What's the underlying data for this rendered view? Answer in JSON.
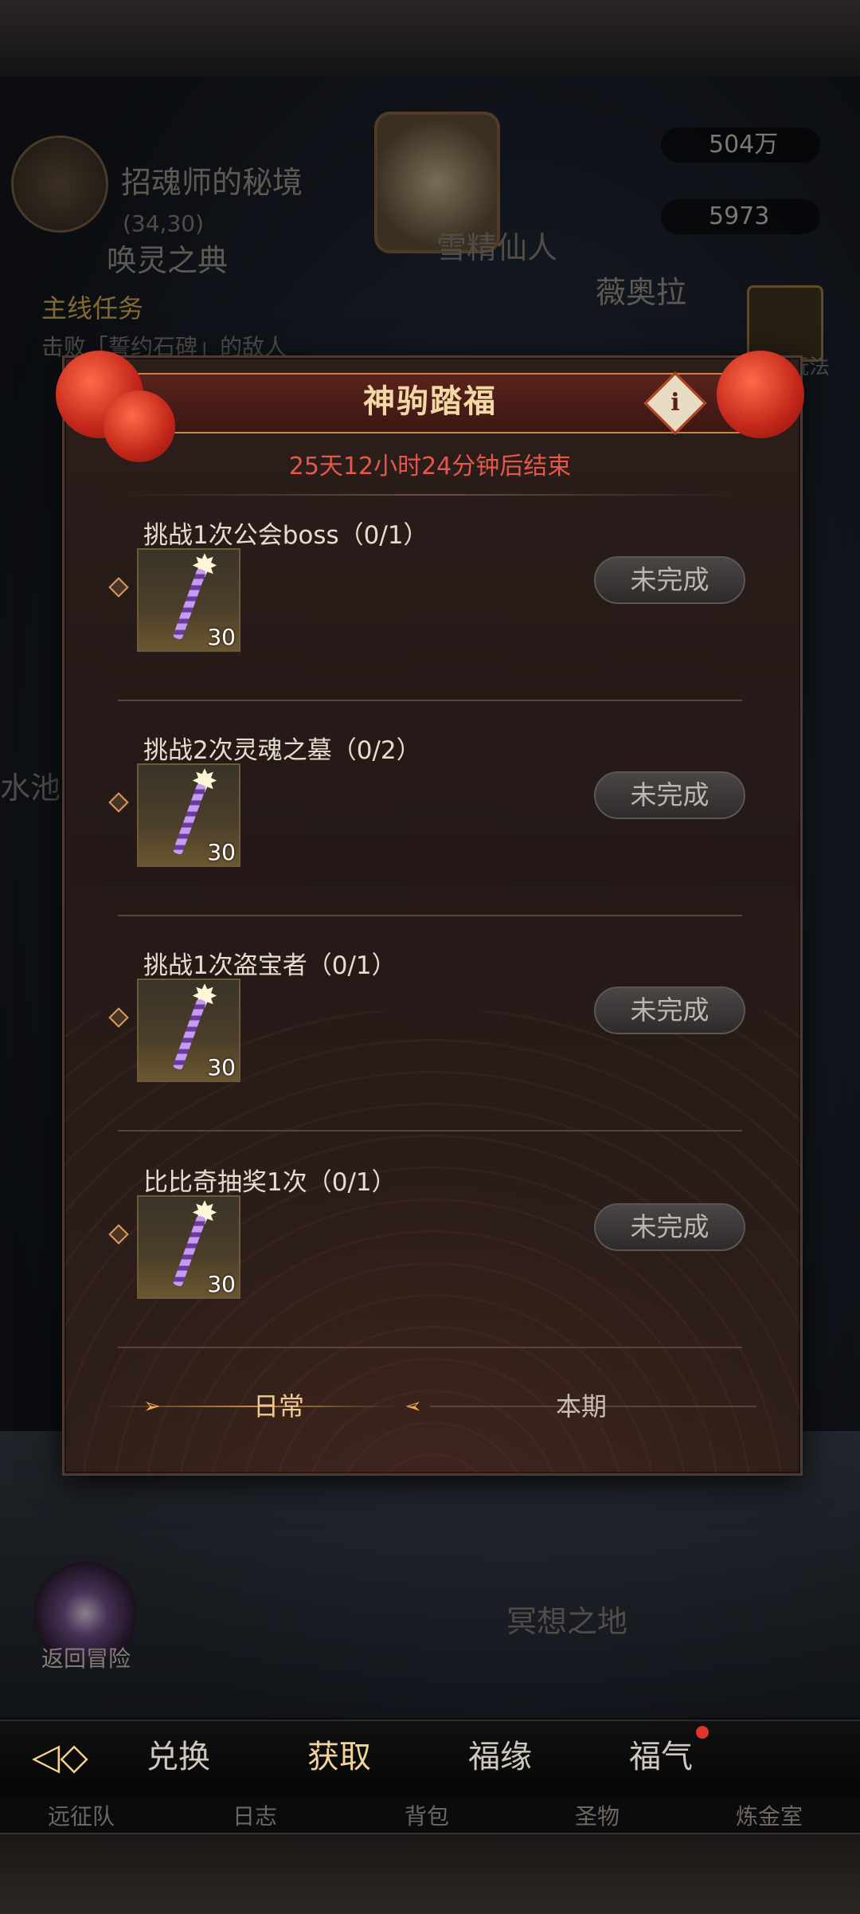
{
  "background": {
    "location_name": "招魂师的秘境",
    "coordinates": "(34,30)",
    "summon_book": "唤灵之典",
    "npc_immortal": "雪精仙人",
    "npc_viola": "薇奥拉",
    "currency_1": "504万",
    "currency_2": "5973",
    "quest_header": "主线任务",
    "quest_text": "击败「誓约石碑」的敌人",
    "side_label_pool": "水池",
    "right_label_play": "玩法",
    "return_adventure": "返回冒险",
    "meditation_place": "冥想之地"
  },
  "modal": {
    "title": "神驹踏福",
    "info_glyph": "i",
    "timer": "25天12小时24分钟后结束",
    "tasks": [
      {
        "title": "挑战1次公会boss（0/1）",
        "reward_count": "30",
        "status": "未完成"
      },
      {
        "title": "挑战2次灵魂之墓（0/2）",
        "reward_count": "30",
        "status": "未完成"
      },
      {
        "title": "挑战1次盗宝者（0/1）",
        "reward_count": "30",
        "status": "未完成"
      },
      {
        "title": "比比奇抽奖1次（0/1）",
        "reward_count": "30",
        "status": "未完成"
      }
    ],
    "tabs": {
      "daily": "日常",
      "period": "本期"
    }
  },
  "bottom_nav": {
    "exchange": "兑换",
    "obtain": "获取",
    "fortune": "福缘",
    "blessing": "福气"
  },
  "under_nav": [
    "远征队",
    "日志",
    "背包",
    "圣物",
    "炼金室"
  ],
  "colors": {
    "accent": "#f0c890",
    "timer": "#e6574a",
    "lantern": "#c3261a"
  }
}
